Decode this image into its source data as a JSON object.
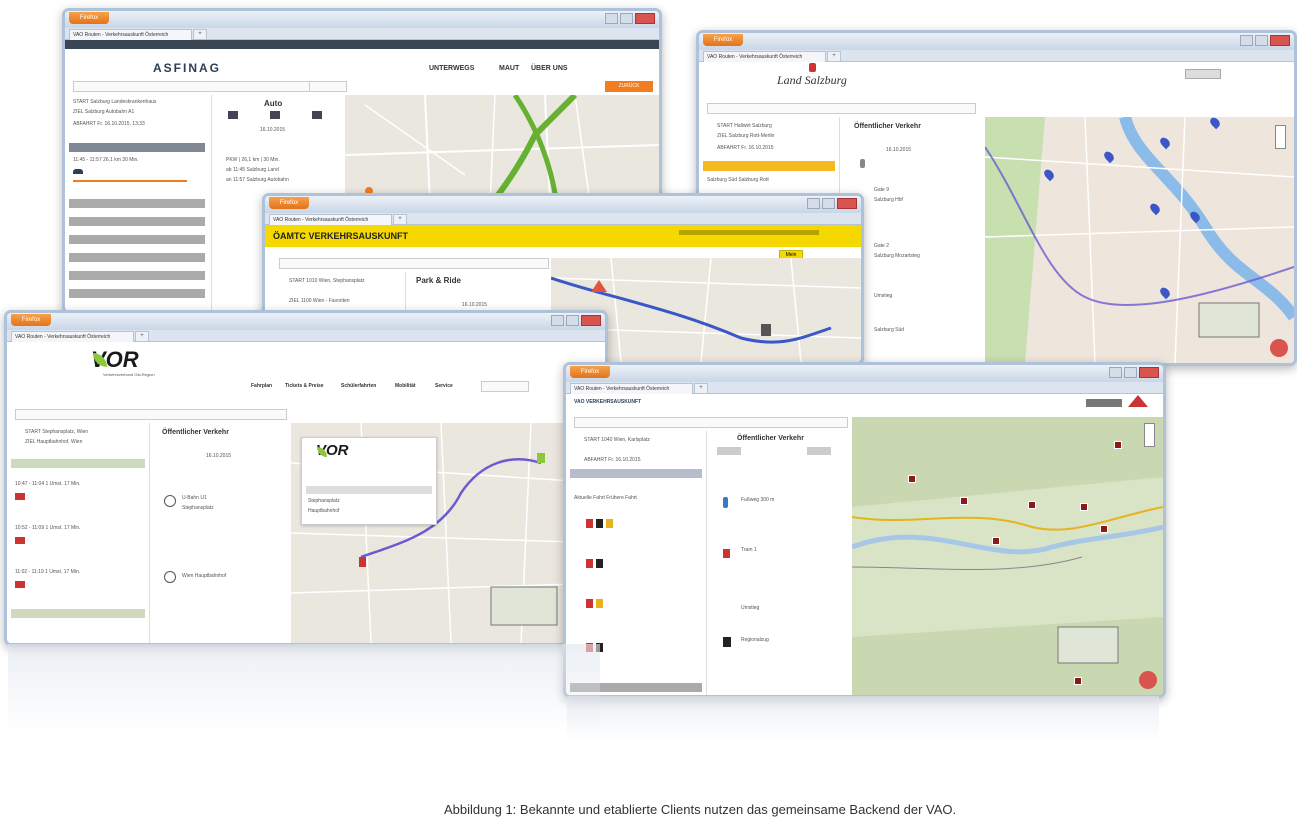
{
  "caption": "Abbildung 1: Bekannte und etablierte Clients nutzen das gemeinsame Backend der VAO.",
  "browser": {
    "menu_label": "Firefox",
    "tab_title": "VAO Routen - Verkehrsauskunft Österreich",
    "new_tab_symbol": "+"
  },
  "asfinag": {
    "logo": "ASFINAG",
    "nav": [
      "UNTERWEGS",
      "MAUT",
      "ÜBER UNS"
    ],
    "section_title": "Auto",
    "action_label": "ZURÜCK"
  },
  "salzburg": {
    "logo": "Land Salzburg",
    "section_title": "Öffentlicher Verkehr",
    "banner": "Öffentlicher Verkehr"
  },
  "oamtc": {
    "logo": "ÖAMTC VERKEHRSAUSKUNFT",
    "section_title": "Park & Ride",
    "login_label": "Mein"
  },
  "vor": {
    "logo": "VOR",
    "subtitle": "Verkehrsverbund Ost-Region",
    "map_logo": "VOR",
    "section_title": "Öffentlicher Verkehr",
    "nav": [
      "Fahrplan",
      "Tickets & Preise",
      "Schülerfahrten",
      "Mobilität",
      "Service"
    ]
  },
  "vao": {
    "section_title": "Öffentlicher Verkehr",
    "header_label": "VAO VERKEHRSAUSKUNFT"
  },
  "icons": [
    "car-icon",
    "train-icon",
    "walk-icon",
    "pin-icon",
    "tram-icon",
    "close-icon"
  ],
  "colors": {
    "titlebar": "#c9d6e6",
    "firefox": "#e2731b",
    "oamtc_yellow": "#f4d800",
    "vor_green": "#8dc63f",
    "pin_blue": "#3b56c7",
    "route_purple": "#6b5bd1",
    "route_green": "#66b032"
  }
}
